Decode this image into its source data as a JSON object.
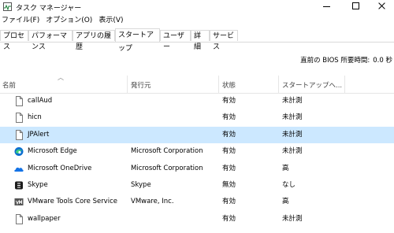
{
  "window": {
    "title": "タスク マネージャー"
  },
  "menu": [
    "ファイル(F)",
    "オプション(O)",
    "表示(V)"
  ],
  "tabs": [
    {
      "label": "プロセス"
    },
    {
      "label": "パフォーマンス"
    },
    {
      "label": "アプリの履歴"
    },
    {
      "label": "スタートアップ",
      "active": true
    },
    {
      "label": "ユーザー"
    },
    {
      "label": "詳細"
    },
    {
      "label": "サービス"
    }
  ],
  "startup_time": {
    "label": "直前の BIOS 所要時間:",
    "value": "0.0 秒"
  },
  "columns": {
    "name": "名前",
    "publisher": "発行元",
    "status": "状態",
    "impact": "スタートアップへ..."
  },
  "rows": [
    {
      "icon": "file-icon",
      "name": "callAud",
      "publisher": "",
      "status": "有効",
      "impact": "未計測"
    },
    {
      "icon": "file-icon",
      "name": "hicn",
      "publisher": "",
      "status": "有効",
      "impact": "未計測"
    },
    {
      "icon": "file-icon",
      "name": "JPAlert",
      "publisher": "",
      "status": "有効",
      "impact": "未計測",
      "selected": true
    },
    {
      "icon": "edge-icon",
      "name": "Microsoft Edge",
      "publisher": "Microsoft Corporation",
      "status": "有効",
      "impact": "未計測"
    },
    {
      "icon": "onedrive-icon",
      "name": "Microsoft OneDrive",
      "publisher": "Microsoft Corporation",
      "status": "有効",
      "impact": "高"
    },
    {
      "icon": "skype-icon",
      "name": "Skype",
      "publisher": "Skype",
      "status": "無効",
      "impact": "なし"
    },
    {
      "icon": "vmware-icon",
      "name": "VMware Tools Core Service",
      "publisher": "VMware, Inc.",
      "status": "有効",
      "impact": "高"
    },
    {
      "icon": "file-icon",
      "name": "wallpaper",
      "publisher": "",
      "status": "有効",
      "impact": "未計測"
    }
  ]
}
